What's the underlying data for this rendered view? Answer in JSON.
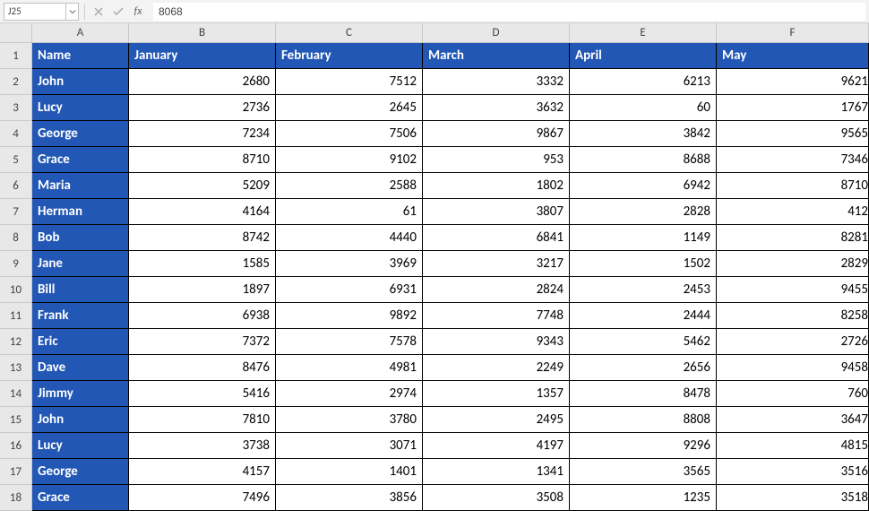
{
  "formulaBar": {
    "nameBox": "J25",
    "formulaValue": "8068"
  },
  "columnLetters": [
    "A",
    "B",
    "C",
    "D",
    "E",
    "F"
  ],
  "headerRow": {
    "rowNum": "1",
    "cells": [
      "Name",
      "January",
      "February",
      "March",
      "April",
      "May"
    ]
  },
  "dataRows": [
    {
      "rowNum": "2",
      "name": "John",
      "values": [
        "2680",
        "7512",
        "3332",
        "6213",
        "9621"
      ]
    },
    {
      "rowNum": "3",
      "name": "Lucy",
      "values": [
        "2736",
        "2645",
        "3632",
        "60",
        "1767"
      ]
    },
    {
      "rowNum": "4",
      "name": "George",
      "values": [
        "7234",
        "7506",
        "9867",
        "3842",
        "9565"
      ]
    },
    {
      "rowNum": "5",
      "name": "Grace",
      "values": [
        "8710",
        "9102",
        "953",
        "8688",
        "7346"
      ]
    },
    {
      "rowNum": "6",
      "name": "Maria",
      "values": [
        "5209",
        "2588",
        "1802",
        "6942",
        "8710"
      ]
    },
    {
      "rowNum": "7",
      "name": "Herman",
      "values": [
        "4164",
        "61",
        "3807",
        "2828",
        "412"
      ]
    },
    {
      "rowNum": "8",
      "name": "Bob",
      "values": [
        "8742",
        "4440",
        "6841",
        "1149",
        "8281"
      ]
    },
    {
      "rowNum": "9",
      "name": "Jane",
      "values": [
        "1585",
        "3969",
        "3217",
        "1502",
        "2829"
      ]
    },
    {
      "rowNum": "10",
      "name": "Bill",
      "values": [
        "1897",
        "6931",
        "2824",
        "2453",
        "9455"
      ]
    },
    {
      "rowNum": "11",
      "name": "Frank",
      "values": [
        "6938",
        "9892",
        "7748",
        "2444",
        "8258"
      ]
    },
    {
      "rowNum": "12",
      "name": "Eric",
      "values": [
        "7372",
        "7578",
        "9343",
        "5462",
        "2726"
      ]
    },
    {
      "rowNum": "13",
      "name": "Dave",
      "values": [
        "8476",
        "4981",
        "2249",
        "2656",
        "9458"
      ]
    },
    {
      "rowNum": "14",
      "name": "Jimmy",
      "values": [
        "5416",
        "2974",
        "1357",
        "8478",
        "760"
      ]
    },
    {
      "rowNum": "15",
      "name": "John",
      "values": [
        "7810",
        "3780",
        "2495",
        "8808",
        "3647"
      ]
    },
    {
      "rowNum": "16",
      "name": "Lucy",
      "values": [
        "3738",
        "3071",
        "4197",
        "9296",
        "4815"
      ]
    },
    {
      "rowNum": "17",
      "name": "George",
      "values": [
        "4157",
        "1401",
        "1341",
        "3565",
        "3516"
      ]
    },
    {
      "rowNum": "18",
      "name": "Grace",
      "values": [
        "7496",
        "3856",
        "3508",
        "1235",
        "3518"
      ]
    }
  ]
}
